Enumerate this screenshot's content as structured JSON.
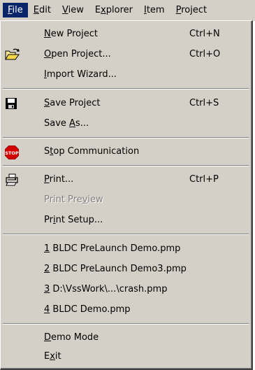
{
  "menubar": {
    "items": [
      {
        "pre": "",
        "ul": "F",
        "post": "ile"
      },
      {
        "pre": "",
        "ul": "E",
        "post": "dit"
      },
      {
        "pre": "",
        "ul": "V",
        "post": "iew"
      },
      {
        "pre": "E",
        "ul": "x",
        "post": "plorer"
      },
      {
        "pre": "",
        "ul": "I",
        "post": "tem"
      },
      {
        "pre": "",
        "ul": "P",
        "post": "roject"
      }
    ]
  },
  "file_menu": {
    "items": [
      {
        "pre": "",
        "ul": "N",
        "post": "ew Project",
        "shortcut": "Ctrl+N",
        "icon": "none",
        "enabled": true
      },
      {
        "pre": "",
        "ul": "O",
        "post": "pen Project...",
        "shortcut": "Ctrl+O",
        "icon": "open-folder-icon",
        "enabled": true
      },
      {
        "pre": "",
        "ul": "I",
        "post": "mport Wizard...",
        "shortcut": "",
        "icon": "none",
        "enabled": true
      },
      {
        "pre": "",
        "ul": "S",
        "post": "ave Project",
        "shortcut": "Ctrl+S",
        "icon": "floppy-disk-icon",
        "enabled": true
      },
      {
        "pre": "Save ",
        "ul": "A",
        "post": "s...",
        "shortcut": "",
        "icon": "none",
        "enabled": true
      },
      {
        "pre": "S",
        "ul": "t",
        "post": "op Communication",
        "shortcut": "",
        "icon": "stop-sign-icon",
        "enabled": true
      },
      {
        "pre": "",
        "ul": "P",
        "post": "rint...",
        "shortcut": "Ctrl+P",
        "icon": "printer-icon",
        "enabled": true
      },
      {
        "pre": "Print Pre",
        "ul": "v",
        "post": "iew",
        "shortcut": "",
        "icon": "none",
        "enabled": false
      },
      {
        "pre": "Pr",
        "ul": "i",
        "post": "nt Setup...",
        "shortcut": "",
        "icon": "none",
        "enabled": true
      },
      {
        "pre": "",
        "ul": "1",
        "post": " BLDC PreLaunch Demo.pmp",
        "shortcut": "",
        "icon": "none",
        "enabled": true
      },
      {
        "pre": "",
        "ul": "2",
        "post": " BLDC PreLaunch Demo3.pmp",
        "shortcut": "",
        "icon": "none",
        "enabled": true
      },
      {
        "pre": "",
        "ul": "3",
        "post": " D:\\VssWork\\...\\crash.pmp",
        "shortcut": "",
        "icon": "none",
        "enabled": true
      },
      {
        "pre": "",
        "ul": "4",
        "post": " BLDC Demo.pmp",
        "shortcut": "",
        "icon": "none",
        "enabled": true
      },
      {
        "pre": "",
        "ul": "D",
        "post": "emo Mode",
        "shortcut": "",
        "icon": "none",
        "enabled": true
      },
      {
        "pre": "E",
        "ul": "x",
        "post": "it",
        "shortcut": "",
        "icon": "none",
        "enabled": true
      }
    ],
    "icon_stop_text": "STOP"
  },
  "colors": {
    "menu_face": "#d4d0c8",
    "highlight": "#0a246a",
    "disabled_text": "#808080",
    "stop_red": "#d40000"
  }
}
